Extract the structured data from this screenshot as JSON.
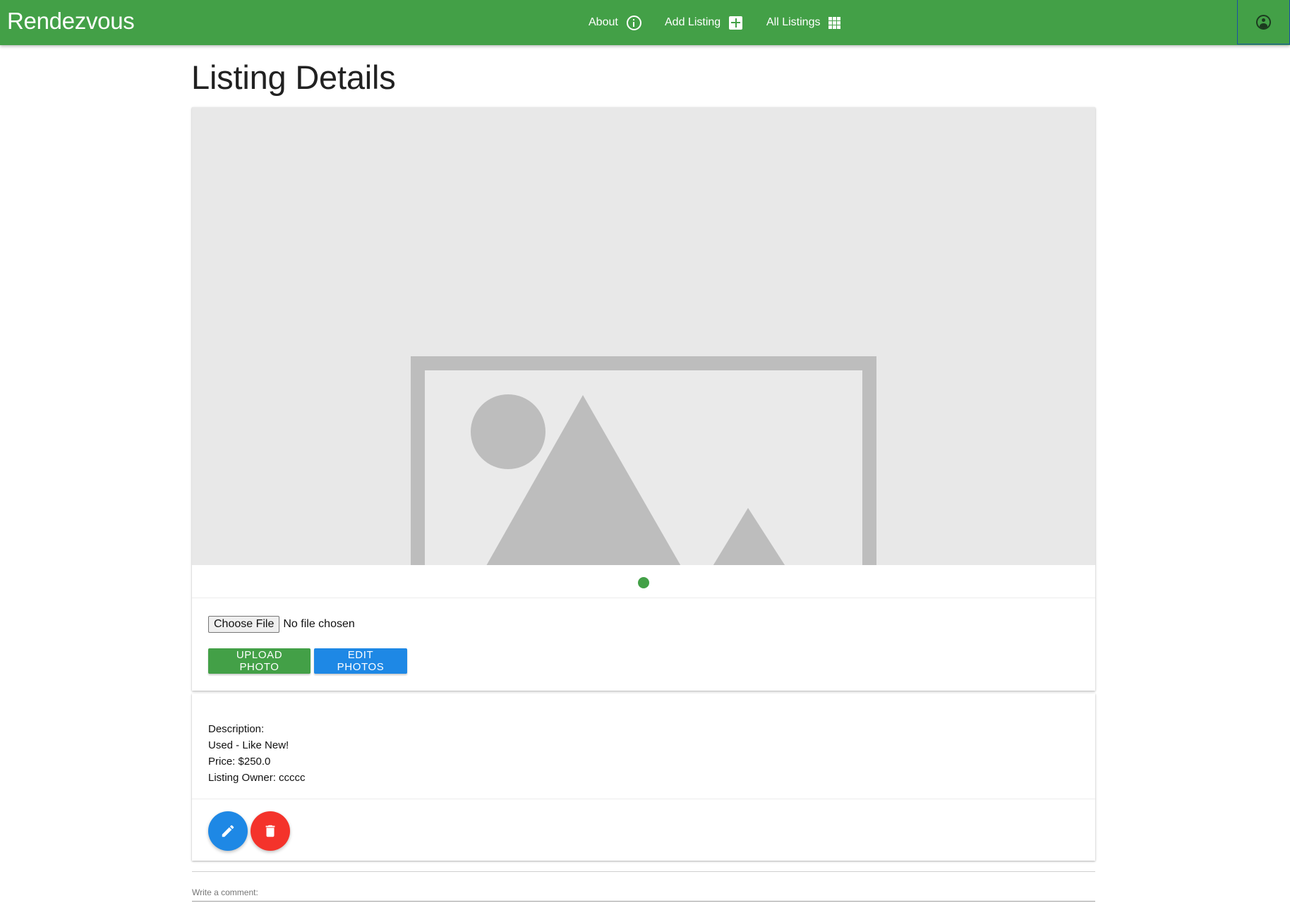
{
  "header": {
    "brand": "Rendezvous",
    "nav": [
      {
        "label": "About",
        "icon": "info-icon"
      },
      {
        "label": "Add Listing",
        "icon": "add-box-icon"
      },
      {
        "label": "All Listings",
        "icon": "grid-icon"
      }
    ],
    "account_icon": "account-icon"
  },
  "page": {
    "title": "Listing Details"
  },
  "photo": {
    "placeholder_icon": "image-placeholder-icon",
    "carousel_dots": 1
  },
  "upload": {
    "choose_file_label": "Choose File",
    "no_file_text": "No file chosen",
    "upload_button": "UPLOAD PHOTO",
    "edit_button": "EDIT PHOTOS"
  },
  "listing": {
    "description_label": "Description:",
    "description": "Used - Like New!",
    "price": "Price: $250.0",
    "owner": "Listing Owner: ccccc"
  },
  "actions": {
    "edit_icon": "pencil-icon",
    "delete_icon": "trash-icon"
  },
  "comments": {
    "label": "Write a comment:"
  },
  "colors": {
    "primary_green": "#43a047",
    "blue": "#1e88e5",
    "red": "#f4332b"
  }
}
